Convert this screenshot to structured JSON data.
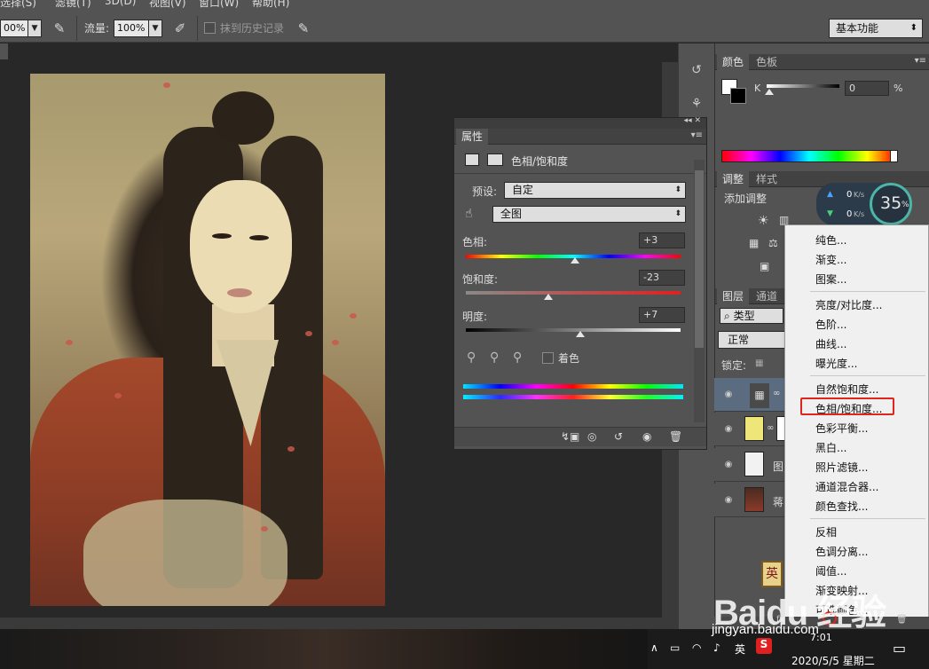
{
  "menubar": {
    "items": [
      "选择(S)",
      "滤镜(T)",
      "3D(D)",
      "视图(V)",
      "窗口(W)",
      "帮助(H)"
    ]
  },
  "options": {
    "opacity_value": "00%",
    "flow_label": "流量:",
    "flow_value": "100%",
    "erase_history_label": "抹到历史记录",
    "workspace": "基本功能"
  },
  "color_panel": {
    "tabs": [
      "颜色",
      "色板"
    ],
    "k_label": "K",
    "k_value": "0",
    "k_unit": "%"
  },
  "adjust_panel": {
    "tabs": [
      "调整",
      "样式"
    ],
    "add_label": "添加调整"
  },
  "speed_widget": {
    "up": "0",
    "down": "0",
    "unit": "K/s",
    "percent": "35",
    "percent_unit": "%"
  },
  "properties": {
    "tab": "属性",
    "title": "色相/饱和度",
    "preset_label": "预设:",
    "preset_value": "自定",
    "channel_value": "全图",
    "hue_label": "色相:",
    "hue_value": "+3",
    "hue_fraction": 0.51,
    "sat_label": "饱和度:",
    "sat_value": "-23",
    "sat_fraction": 0.385,
    "light_label": "明度:",
    "light_value": "+7",
    "light_fraction": 0.535,
    "colorize_label": "着色"
  },
  "layers_panel": {
    "tabs": [
      "图层",
      "通道"
    ],
    "kind_label": "类型",
    "blend_mode": "正常",
    "lock_label": "锁定:",
    "layer_names": [
      "图",
      "蒋"
    ]
  },
  "context_menu": {
    "groups": [
      [
        "纯色...",
        "渐变...",
        "图案..."
      ],
      [
        "亮度/对比度...",
        "色阶...",
        "曲线...",
        "曝光度..."
      ],
      [
        "自然饱和度...",
        "色相/饱和度...",
        "色彩平衡...",
        "黑白...",
        "照片滤镜...",
        "通道混合器...",
        "颜色查找..."
      ],
      [
        "反相",
        "色调分离...",
        "阈值...",
        "渐变映射...",
        "可选颜色..."
      ]
    ]
  },
  "watermark": {
    "brand": "Baidu 经验",
    "url": "jingyan.baidu.com"
  },
  "taskbar": {
    "ime": "英",
    "datetime": "2020/5/5 星期二",
    "time_partial": "7:01"
  },
  "colors": {
    "ps_bg": "#535353",
    "highlight": "#e0261b"
  }
}
